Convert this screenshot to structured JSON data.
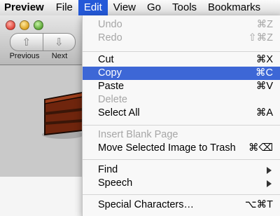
{
  "menubar": {
    "items": [
      {
        "label": "Preview",
        "active": false
      },
      {
        "label": "File",
        "active": false
      },
      {
        "label": "Edit",
        "active": true
      },
      {
        "label": "View",
        "active": false
      },
      {
        "label": "Go",
        "active": false
      },
      {
        "label": "Tools",
        "active": false
      },
      {
        "label": "Bookmarks",
        "active": false
      }
    ]
  },
  "toolbar": {
    "previous_label": "Previous",
    "next_label": "Next"
  },
  "colors": {
    "accent": "#2459d8",
    "highlight": "#3d67d6",
    "cake": "#7a2a10"
  },
  "edit_menu": {
    "items": [
      {
        "label": "Undo",
        "shortcut": "⌘Z",
        "enabled": false
      },
      {
        "label": "Redo",
        "shortcut": "⇧⌘Z",
        "enabled": false
      },
      {
        "label": "Cut",
        "shortcut": "⌘X",
        "enabled": true
      },
      {
        "label": "Copy",
        "shortcut": "⌘C",
        "enabled": true,
        "highlighted": true
      },
      {
        "label": "Paste",
        "shortcut": "⌘V",
        "enabled": true
      },
      {
        "label": "Delete",
        "shortcut": "",
        "enabled": false
      },
      {
        "label": "Select All",
        "shortcut": "⌘A",
        "enabled": true
      },
      {
        "label": "Insert Blank Page",
        "shortcut": "",
        "enabled": false
      },
      {
        "label": "Move Selected Image to Trash",
        "shortcut": "⌘⌫",
        "enabled": true
      },
      {
        "label": "Find",
        "shortcut": "",
        "enabled": true,
        "submenu": true
      },
      {
        "label": "Speech",
        "shortcut": "",
        "enabled": true,
        "submenu": true
      },
      {
        "label": "Special Characters…",
        "shortcut": "⌥⌘T",
        "enabled": true
      }
    ]
  }
}
